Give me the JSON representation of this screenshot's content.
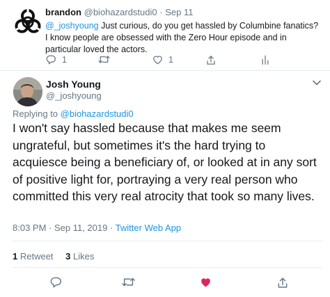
{
  "parent": {
    "name": "brandon",
    "handle": "@biohazardstudi0",
    "separator": "·",
    "date": "Sep 11",
    "text_mention": "@_joshyoung",
    "text_rest": " Just curious, do you get hassled by Columbine fanatics? I know people are obsessed with the Zero Hour episode and in particular loved the actors.",
    "reply_count": "1",
    "like_count": "1",
    "avatar_icon": "biohazard-icon"
  },
  "tweet": {
    "name": "Josh Young",
    "handle": "@_joshyoung",
    "replying_prefix": "Replying to ",
    "replying_handle": "@biohazardstudi0",
    "text": "I won't say hassled because that makes me seem ungrateful, but sometimes it's the hard trying to acquiesce being a beneficiary of, or looked at in any sort of positive light for, portraying a very real person who committed this very real atrocity that took so many lives.",
    "timestamp": "8:03 PM · Sep 11, 2019 · ",
    "source": "Twitter Web App",
    "retweet_count": "1",
    "retweet_label": " Retweet",
    "like_count": "3",
    "like_label": " Likes"
  },
  "colors": {
    "accent": "#1b95e0",
    "muted": "#657786",
    "text": "#14171a",
    "like_active": "#e0245e",
    "divider": "#e6ecf0"
  },
  "icons": [
    "reply-icon",
    "retweet-icon",
    "like-icon",
    "share-icon",
    "analytics-icon",
    "chevron-down-icon"
  ]
}
